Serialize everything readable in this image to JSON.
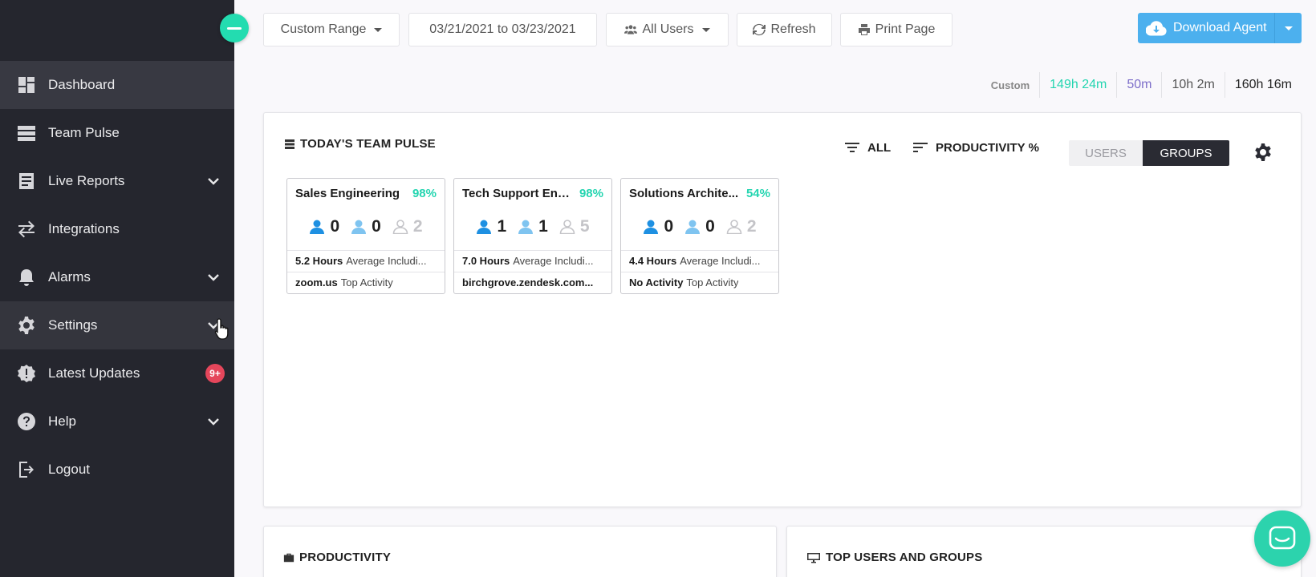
{
  "sidebar": {
    "items": [
      {
        "label": "Dashboard",
        "icon": "dashboard-icon"
      },
      {
        "label": "Team Pulse",
        "icon": "team-pulse-icon"
      },
      {
        "label": "Live Reports",
        "icon": "live-reports-icon"
      },
      {
        "label": "Integrations",
        "icon": "integrations-icon"
      },
      {
        "label": "Alarms",
        "icon": "bell-icon"
      },
      {
        "label": "Settings",
        "icon": "gear-icon"
      },
      {
        "label": "Latest Updates",
        "icon": "updates-icon",
        "badge": "9+"
      },
      {
        "label": "Help",
        "icon": "help-icon"
      },
      {
        "label": "Logout",
        "icon": "logout-icon"
      }
    ]
  },
  "toolbar": {
    "range_label": "Custom Range",
    "date_range": "03/21/2021 to 03/23/2021",
    "users_label": "All Users",
    "refresh_label": "Refresh",
    "print_label": "Print Page",
    "download_label": "Download Agent"
  },
  "time_summary": {
    "label": "Custom",
    "productive": "149h 24m",
    "unproductive": "50m",
    "neutral": "10h 2m",
    "total": "160h 16m"
  },
  "team_pulse": {
    "title": "TODAY'S TEAM PULSE",
    "filter_all": "ALL",
    "sort_label": "PRODUCTIVITY %",
    "toggle_users": "USERS",
    "toggle_groups": "GROUPS",
    "groups": [
      {
        "name": "Sales Engineering",
        "pct": "98%",
        "active": "0",
        "idle": "0",
        "offline": "2",
        "hours": "5.2 Hours",
        "hours_label": "Average Includi...",
        "top": "zoom.us",
        "top_label": "Top Activity"
      },
      {
        "name": "Tech Support Eng...",
        "pct": "98%",
        "active": "1",
        "idle": "1",
        "offline": "5",
        "hours": "7.0 Hours",
        "hours_label": "Average Includi...",
        "top": "birchgrove.zendesk.com...",
        "top_label": ""
      },
      {
        "name": "Solutions Archite...",
        "pct": "54%",
        "active": "0",
        "idle": "0",
        "offline": "2",
        "hours": "4.4 Hours",
        "hours_label": "Average Includi...",
        "top": "No Activity",
        "top_label": "Top Activity"
      }
    ]
  },
  "productivity": {
    "title": "PRODUCTIVITY"
  },
  "top_users": {
    "title": "TOP USERS AND GROUPS"
  },
  "colors": {
    "accent": "#23dcb0",
    "sidebar": "#25262e",
    "download": "#4cb0ee",
    "badge": "#e5465b"
  }
}
